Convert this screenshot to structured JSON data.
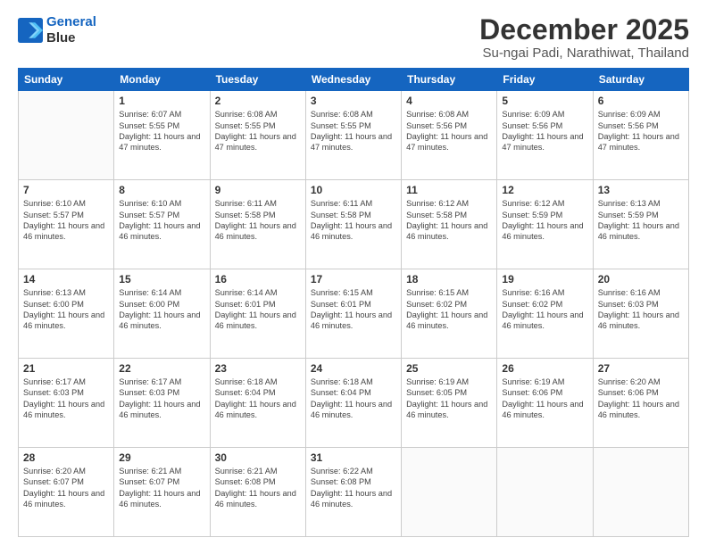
{
  "logo": {
    "line1": "General",
    "line2": "Blue"
  },
  "title": "December 2025",
  "subtitle": "Su-ngai Padi, Narathiwat, Thailand",
  "days": [
    "Sunday",
    "Monday",
    "Tuesday",
    "Wednesday",
    "Thursday",
    "Friday",
    "Saturday"
  ],
  "weeks": [
    [
      {
        "date": "",
        "empty": true
      },
      {
        "date": "1",
        "sunrise": "6:07 AM",
        "sunset": "5:55 PM",
        "daylight": "11 hours and 47 minutes."
      },
      {
        "date": "2",
        "sunrise": "6:08 AM",
        "sunset": "5:55 PM",
        "daylight": "11 hours and 47 minutes."
      },
      {
        "date": "3",
        "sunrise": "6:08 AM",
        "sunset": "5:55 PM",
        "daylight": "11 hours and 47 minutes."
      },
      {
        "date": "4",
        "sunrise": "6:08 AM",
        "sunset": "5:56 PM",
        "daylight": "11 hours and 47 minutes."
      },
      {
        "date": "5",
        "sunrise": "6:09 AM",
        "sunset": "5:56 PM",
        "daylight": "11 hours and 47 minutes."
      },
      {
        "date": "6",
        "sunrise": "6:09 AM",
        "sunset": "5:56 PM",
        "daylight": "11 hours and 47 minutes."
      }
    ],
    [
      {
        "date": "7",
        "sunrise": "6:10 AM",
        "sunset": "5:57 PM",
        "daylight": "11 hours and 46 minutes."
      },
      {
        "date": "8",
        "sunrise": "6:10 AM",
        "sunset": "5:57 PM",
        "daylight": "11 hours and 46 minutes."
      },
      {
        "date": "9",
        "sunrise": "6:11 AM",
        "sunset": "5:58 PM",
        "daylight": "11 hours and 46 minutes."
      },
      {
        "date": "10",
        "sunrise": "6:11 AM",
        "sunset": "5:58 PM",
        "daylight": "11 hours and 46 minutes."
      },
      {
        "date": "11",
        "sunrise": "6:12 AM",
        "sunset": "5:58 PM",
        "daylight": "11 hours and 46 minutes."
      },
      {
        "date": "12",
        "sunrise": "6:12 AM",
        "sunset": "5:59 PM",
        "daylight": "11 hours and 46 minutes."
      },
      {
        "date": "13",
        "sunrise": "6:13 AM",
        "sunset": "5:59 PM",
        "daylight": "11 hours and 46 minutes."
      }
    ],
    [
      {
        "date": "14",
        "sunrise": "6:13 AM",
        "sunset": "6:00 PM",
        "daylight": "11 hours and 46 minutes."
      },
      {
        "date": "15",
        "sunrise": "6:14 AM",
        "sunset": "6:00 PM",
        "daylight": "11 hours and 46 minutes."
      },
      {
        "date": "16",
        "sunrise": "6:14 AM",
        "sunset": "6:01 PM",
        "daylight": "11 hours and 46 minutes."
      },
      {
        "date": "17",
        "sunrise": "6:15 AM",
        "sunset": "6:01 PM",
        "daylight": "11 hours and 46 minutes."
      },
      {
        "date": "18",
        "sunrise": "6:15 AM",
        "sunset": "6:02 PM",
        "daylight": "11 hours and 46 minutes."
      },
      {
        "date": "19",
        "sunrise": "6:16 AM",
        "sunset": "6:02 PM",
        "daylight": "11 hours and 46 minutes."
      },
      {
        "date": "20",
        "sunrise": "6:16 AM",
        "sunset": "6:03 PM",
        "daylight": "11 hours and 46 minutes."
      }
    ],
    [
      {
        "date": "21",
        "sunrise": "6:17 AM",
        "sunset": "6:03 PM",
        "daylight": "11 hours and 46 minutes."
      },
      {
        "date": "22",
        "sunrise": "6:17 AM",
        "sunset": "6:03 PM",
        "daylight": "11 hours and 46 minutes."
      },
      {
        "date": "23",
        "sunrise": "6:18 AM",
        "sunset": "6:04 PM",
        "daylight": "11 hours and 46 minutes."
      },
      {
        "date": "24",
        "sunrise": "6:18 AM",
        "sunset": "6:04 PM",
        "daylight": "11 hours and 46 minutes."
      },
      {
        "date": "25",
        "sunrise": "6:19 AM",
        "sunset": "6:05 PM",
        "daylight": "11 hours and 46 minutes."
      },
      {
        "date": "26",
        "sunrise": "6:19 AM",
        "sunset": "6:06 PM",
        "daylight": "11 hours and 46 minutes."
      },
      {
        "date": "27",
        "sunrise": "6:20 AM",
        "sunset": "6:06 PM",
        "daylight": "11 hours and 46 minutes."
      }
    ],
    [
      {
        "date": "28",
        "sunrise": "6:20 AM",
        "sunset": "6:07 PM",
        "daylight": "11 hours and 46 minutes."
      },
      {
        "date": "29",
        "sunrise": "6:21 AM",
        "sunset": "6:07 PM",
        "daylight": "11 hours and 46 minutes."
      },
      {
        "date": "30",
        "sunrise": "6:21 AM",
        "sunset": "6:08 PM",
        "daylight": "11 hours and 46 minutes."
      },
      {
        "date": "31",
        "sunrise": "6:22 AM",
        "sunset": "6:08 PM",
        "daylight": "11 hours and 46 minutes."
      },
      {
        "date": "",
        "empty": true
      },
      {
        "date": "",
        "empty": true
      },
      {
        "date": "",
        "empty": true
      }
    ]
  ],
  "labels": {
    "sunrise": "Sunrise: ",
    "sunset": "Sunset: ",
    "daylight": "Daylight: "
  }
}
